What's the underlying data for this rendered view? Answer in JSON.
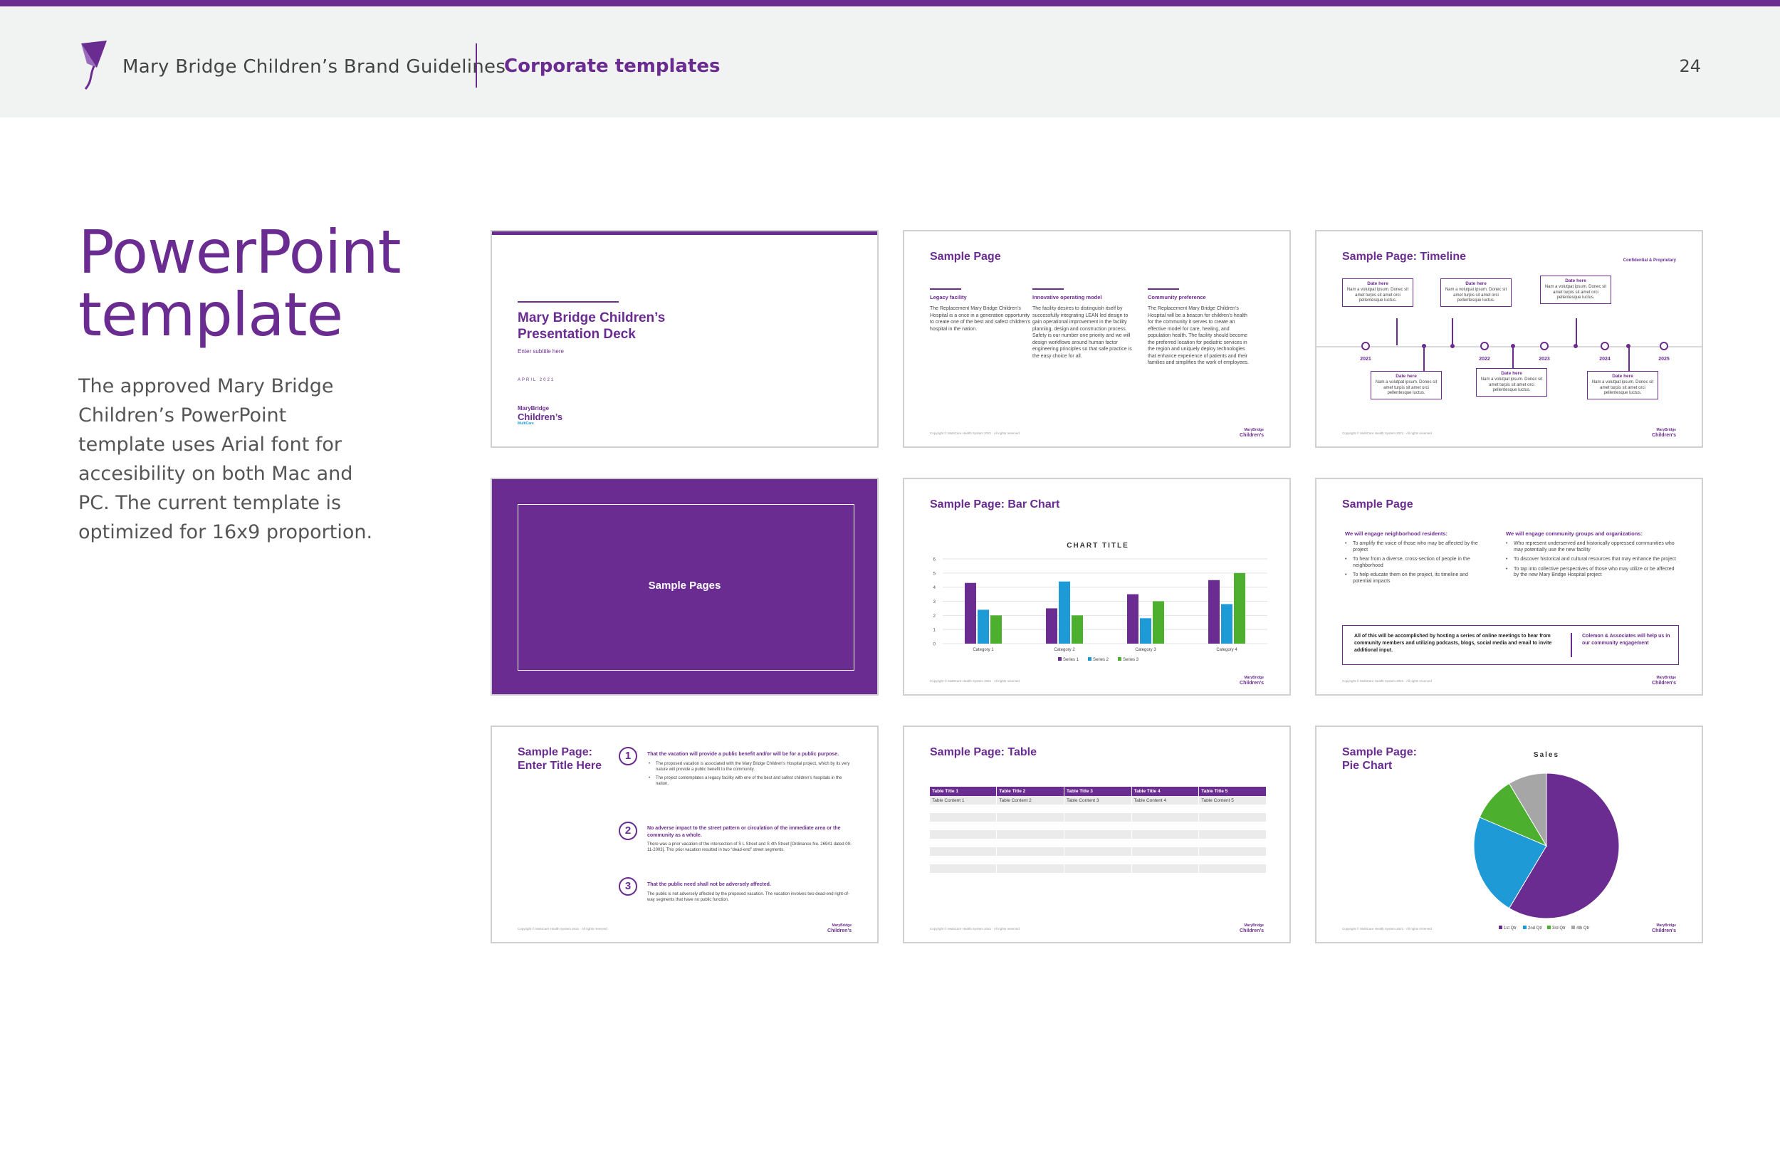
{
  "header": {
    "brand": "Mary Bridge Children’s Brand Guidelines",
    "section": "Corporate templates",
    "page_number": "24",
    "accent_color": "#6b2c91"
  },
  "intro": {
    "title": "PowerPoint template",
    "body": "The approved Mary Bridge Children’s PowerPoint template uses Arial font for accesibility on both Mac and PC. The current template is optimized for 16x9 proportion."
  },
  "slides": {
    "title_slide": {
      "deck_title": "Mary Bridge Children’s Presentation Deck",
      "subtitle": "Enter subtitle here",
      "date": "APRIL 2021",
      "logo_line1": "MaryBridge",
      "logo_line2": "Children’s",
      "logo_line3": "MultiCare"
    },
    "sample_page": {
      "title": "Sample Page",
      "columns": [
        {
          "heading": "Legacy facility",
          "text": "The Replacement Mary Bridge Children’s Hospital is a once in a generation opportunity to create one of the best and safest children’s hospital in the nation."
        },
        {
          "heading": "Innovative operating model",
          "text": "The facility desires to distinguish itself by successfully integrating LEAN led design to gain operational improvement in the facility planning, design and construction process. Safety is our number one priority and we will design workflows around human factor engineering principles so that safe practice is the easy choice for all."
        },
        {
          "heading": "Community preference",
          "text": "The Replacement Mary Bridge Children’s Hospital will be a beacon for children’s health for the community it serves to create an effective model for care, healing, and population health. The facility should become the preferred location for pediatric services in the region and uniquely deploy technologies that enhance experience of patients and their families and simplifies the work of employees."
        }
      ]
    },
    "timeline": {
      "title": "Sample Page: Timeline",
      "confidential": "Confidential & Proprietary",
      "box_heading": "Date here",
      "box_text": "Nam a volutpat ipsum. Donec sit amet turpis sit amet orci pellentesque luctus.",
      "years": [
        "2021",
        "2022",
        "2023",
        "2024",
        "2025"
      ]
    },
    "section_divider": {
      "label": "Sample Pages"
    },
    "bar_chart": {
      "title": "Sample Page: Bar Chart"
    },
    "bullets_page": {
      "title": "Sample Page",
      "left_heading": "We will engage neighborhood residents:",
      "left_items": [
        "To amplify the voice of those who may be affected by the project",
        "To hear from a diverse, cross-section of people in the neighborhood",
        "To help educate them on the project, its timeline and potential impacts"
      ],
      "right_heading": "We will engage community groups and organizations:",
      "right_items": [
        "Who represent underserved and historically oppressed communities who may potentially use the new facility",
        "To discover historical and cultural resources that may enhance the project",
        "To tap into collective perspectives of those who may utilize or be affected by the new Mary Bridge Hospital project"
      ],
      "callout_left": "All of this will be accomplished by hosting a series of online meetings to hear from community members and utilizing podcasts, blogs, social media and email to invite additional input.",
      "callout_right": "Colemon & Associates will help us in our community engagement"
    },
    "numbered_page": {
      "title": "Sample Page: Enter Title Here",
      "items": [
        {
          "num": "1",
          "heading": "That the vacation will provide a public benefit and/or will be for a public purpose.",
          "bullets": [
            "The proposed vacation is associated with the Mary Bridge Children’s Hospital project, which by its very nature will provide a public benefit to the community.",
            "The project contemplates a legacy facility with one of the best and safest children’s hospitals in the nation."
          ]
        },
        {
          "num": "2",
          "heading": "No adverse impact to the street pattern or circulation of the immediate area or the community as a whole.",
          "text": "There was a prior vacation of the intersection of S L Street and S 4th Street [Ordinance No. 26941 dated 09-11-2003]. This prior vacation resulted in two “dead-end” street segments."
        },
        {
          "num": "3",
          "heading": "That the public need shall not be adversely affected.",
          "text": "The public is not adversely affected by the proposed vacation. The vacation involves two dead-end right-of-way segments that have no public function."
        }
      ]
    },
    "table_page": {
      "title": "Sample Page: Table",
      "headers": [
        "Table Title 1",
        "Table Title 2",
        "Table Title  3",
        "Table Title 4",
        "Table Title 5"
      ],
      "first_row": [
        "Table Content 1",
        "Table Content 2",
        "Table Content 3",
        "Table Content 4",
        "Table Content 5"
      ]
    },
    "pie_page": {
      "title": "Sample Page: Pie Chart"
    },
    "footer_text": "Copyright © MultiCare Health System 2021 · All rights reserved",
    "logo_line1": "MaryBridge",
    "logo_line2": "Children’s"
  },
  "chart_data": [
    {
      "type": "bar",
      "title": "CHART TITLE",
      "categories": [
        "Category 1",
        "Category 2",
        "Category 3",
        "Category 4"
      ],
      "series": [
        {
          "name": "Series 1",
          "values": [
            4.3,
            2.5,
            3.5,
            4.5
          ],
          "color": "#6b2c91"
        },
        {
          "name": "Series 2",
          "values": [
            2.4,
            4.4,
            1.8,
            2.8
          ],
          "color": "#1e9ad6"
        },
        {
          "name": "Series 3",
          "values": [
            2,
            2,
            3,
            5
          ],
          "color": "#4caf2e"
        }
      ],
      "ylim": [
        0,
        6
      ],
      "yticks": [
        "0",
        "1",
        "2",
        "3",
        "4",
        "5",
        "6"
      ],
      "legend": "bottom"
    },
    {
      "type": "pie",
      "title": "Sales",
      "labels": [
        "1st Qtr",
        "2nd Qtr",
        "3rd Qtr",
        "4th Qtr"
      ],
      "values": [
        8.2,
        3.2,
        1.4,
        1.2
      ],
      "colors": [
        "#6b2c91",
        "#1e9ad6",
        "#4caf2e",
        "#a6a6a6"
      ],
      "legend": "bottom"
    }
  ]
}
